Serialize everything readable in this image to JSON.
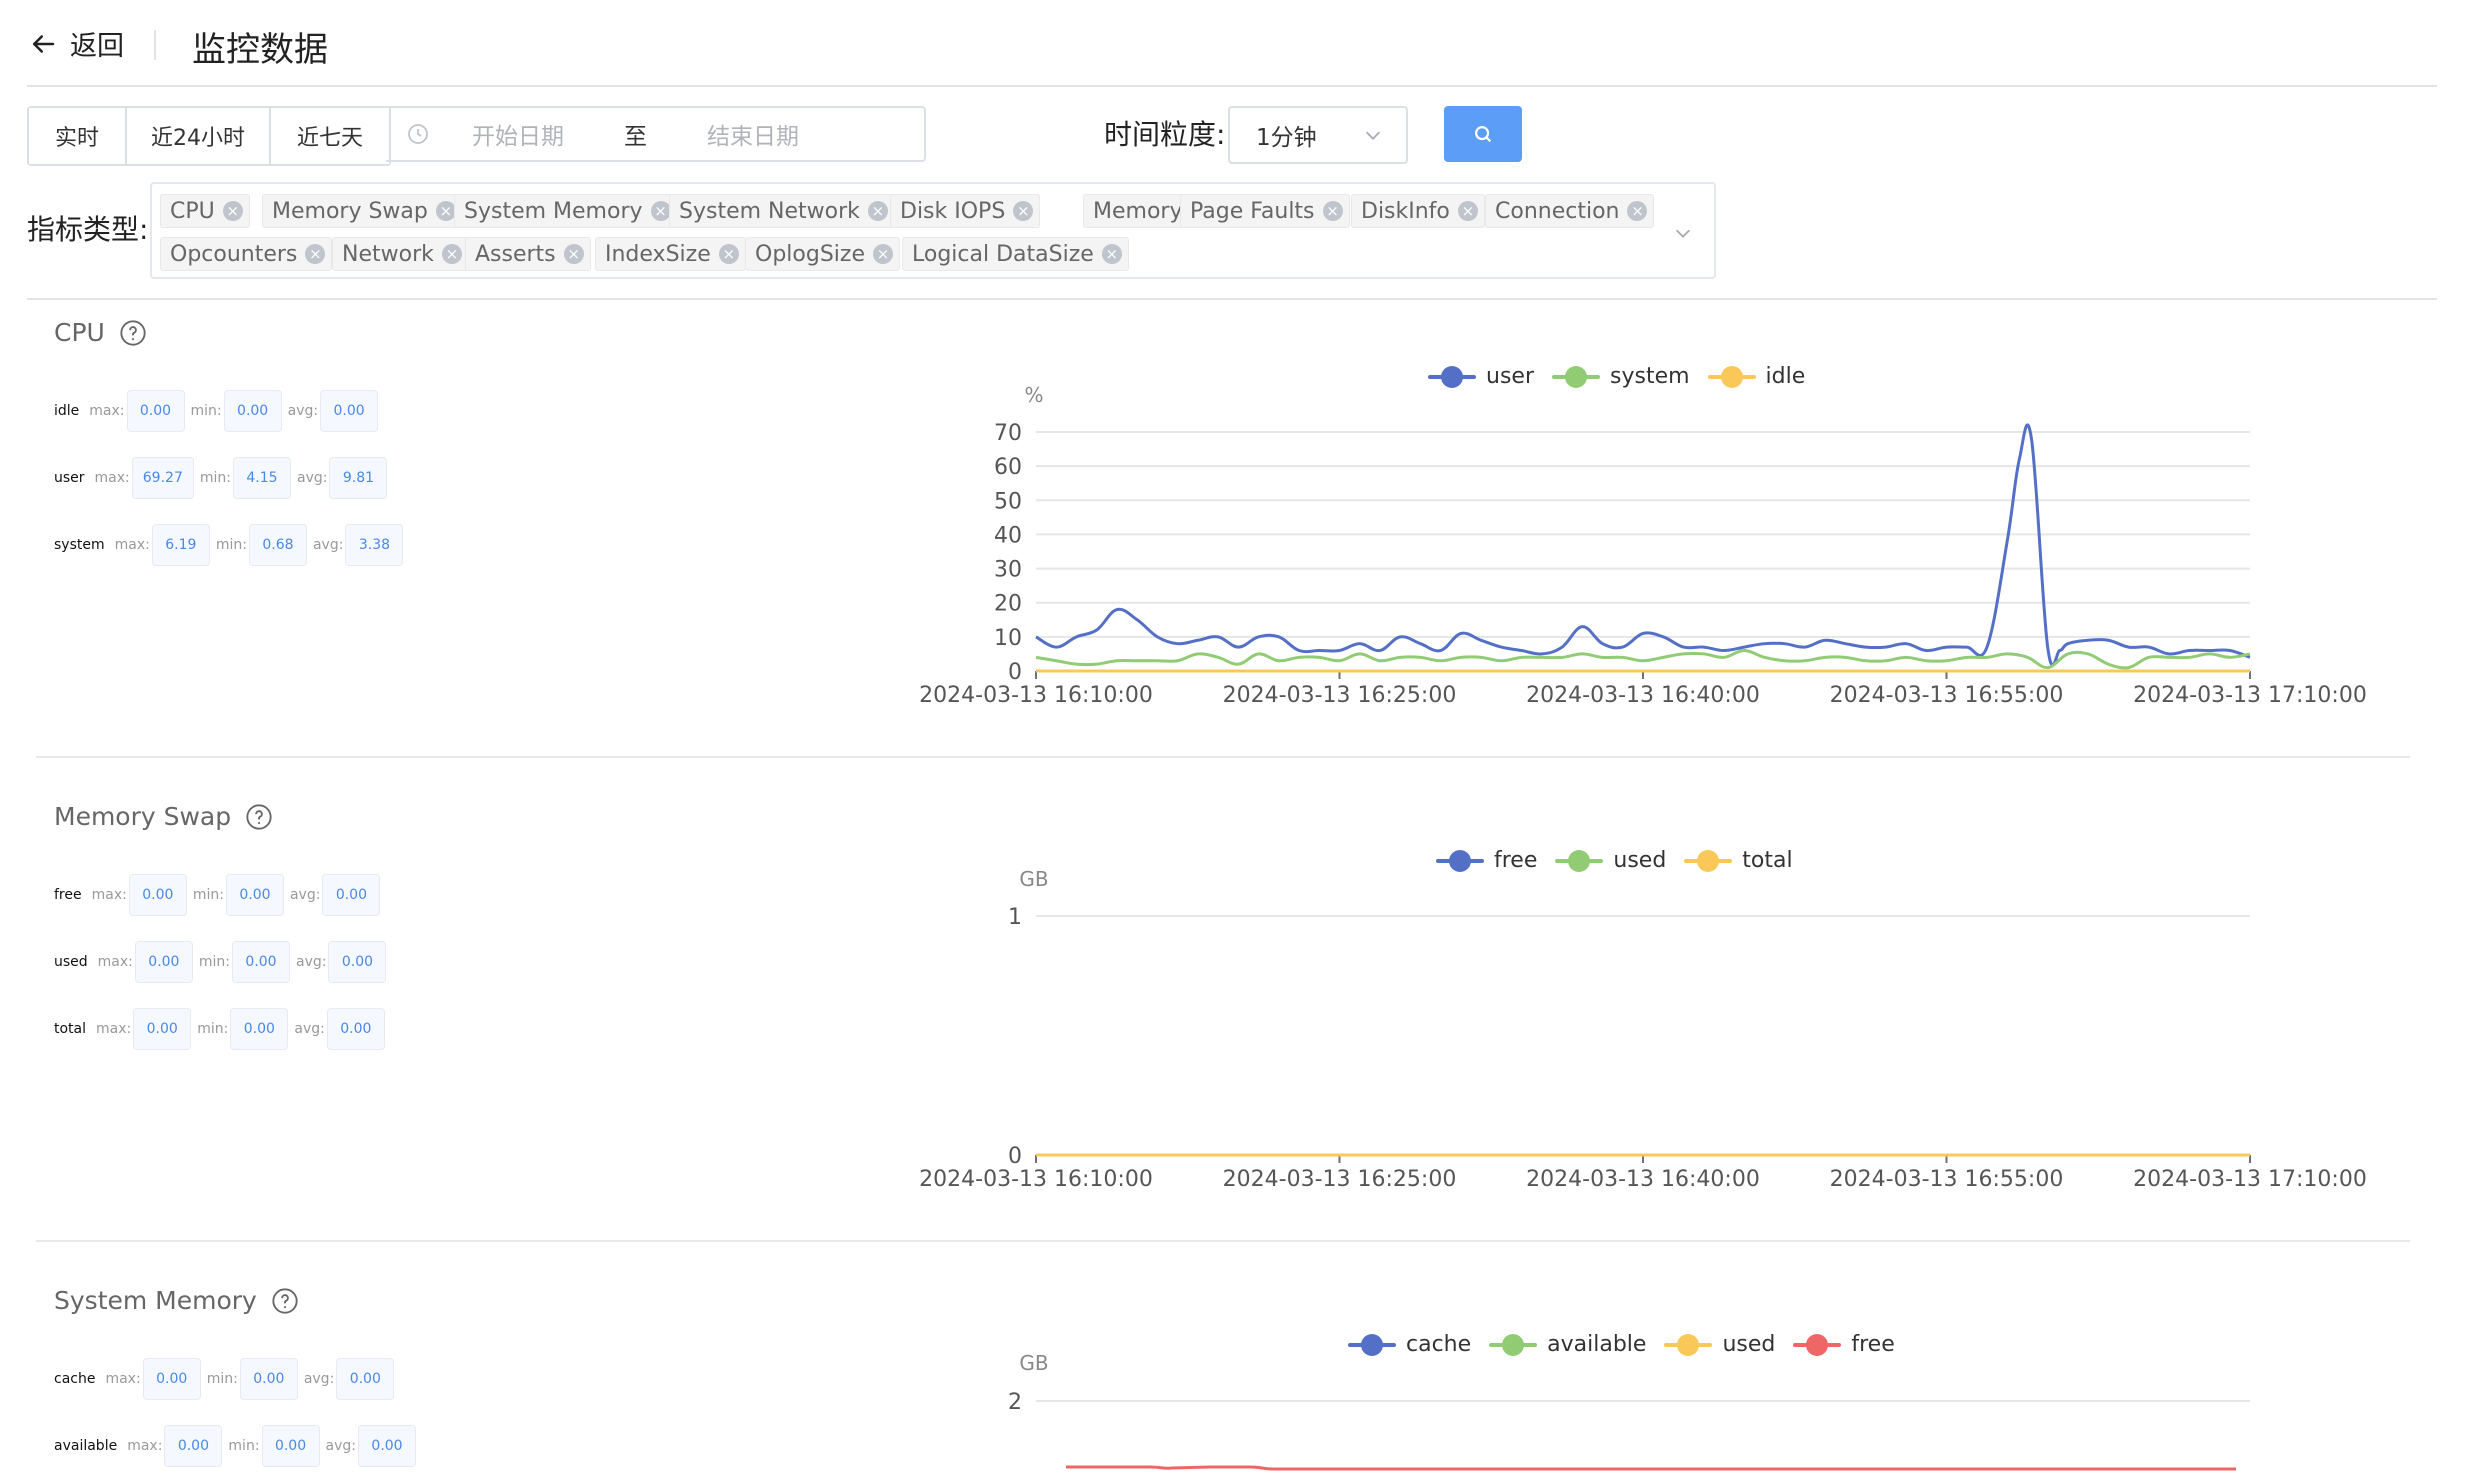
{
  "header": {
    "back_label": "返回",
    "title": "监控数据"
  },
  "toolbar": {
    "quick_ranges": [
      "实时",
      "近24小时",
      "近七天"
    ],
    "start_placeholder": "开始日期",
    "range_separator": "至",
    "end_placeholder": "结束日期",
    "granularity_label": "时间粒度:",
    "granularity_value": "1分钟",
    "metric_type_label": "指标类型:",
    "metric_tags": [
      "CPU",
      "Memory Swap",
      "System Memory",
      "System Network",
      "Disk IOPS",
      "Memory",
      "Page Faults",
      "DiskInfo",
      "Connection",
      "Opcounters",
      "Network",
      "Asserts",
      "IndexSize",
      "OplogSize",
      "Logical DataSize"
    ]
  },
  "colors": {
    "blue": "#5470c6",
    "green": "#91cc75",
    "yellow": "#fac858",
    "red": "#ee6666",
    "primary": "#5b9df7"
  },
  "sections": [
    {
      "title": "CPU",
      "stats": [
        {
          "name": "idle",
          "max": "0.00",
          "min": "0.00",
          "avg": "0.00"
        },
        {
          "name": "user",
          "max": "69.27",
          "min": "4.15",
          "avg": "9.81"
        },
        {
          "name": "system",
          "max": "6.19",
          "min": "0.68",
          "avg": "3.38"
        }
      ]
    },
    {
      "title": "Memory Swap",
      "stats": [
        {
          "name": "free",
          "max": "0.00",
          "min": "0.00",
          "avg": "0.00"
        },
        {
          "name": "used",
          "max": "0.00",
          "min": "0.00",
          "avg": "0.00"
        },
        {
          "name": "total",
          "max": "0.00",
          "min": "0.00",
          "avg": "0.00"
        }
      ]
    },
    {
      "title": "System Memory",
      "stats": [
        {
          "name": "cache",
          "max": "0.00",
          "min": "0.00",
          "avg": "0.00"
        },
        {
          "name": "available",
          "max": "0.00",
          "min": "0.00",
          "avg": "0.00"
        }
      ]
    }
  ],
  "stat_labels": {
    "max": "max:",
    "min": "min:",
    "avg": "avg:"
  },
  "chart_data": [
    {
      "type": "line",
      "unit": "%",
      "ylim": [
        0,
        70
      ],
      "yticks": [
        0,
        10,
        20,
        30,
        40,
        50,
        60,
        70
      ],
      "x_tick_labels": [
        "2024-03-13 16:10:00",
        "2024-03-13 16:25:00",
        "2024-03-13 16:40:00",
        "2024-03-13 16:55:00",
        "2024-03-13 17:10:00"
      ],
      "x_range_minutes": [
        0,
        60
      ],
      "series": [
        {
          "name": "user",
          "color": "#5470c6",
          "x": [
            0,
            1,
            2,
            3,
            4,
            5,
            6,
            7,
            8,
            9,
            10,
            11,
            12,
            13,
            14,
            15,
            16,
            17,
            18,
            19,
            20,
            21,
            22,
            23,
            24,
            25,
            26,
            27,
            28,
            29,
            30,
            31,
            32,
            33,
            34,
            35,
            36,
            37,
            38,
            39,
            40,
            41,
            42,
            43,
            44,
            45,
            46,
            47,
            48,
            48.6,
            49.2,
            50,
            50.6,
            51,
            52,
            53,
            54,
            55,
            56,
            57,
            58,
            59,
            60
          ],
          "y": [
            10,
            7,
            10,
            12,
            18,
            15,
            10,
            8,
            9,
            10,
            7,
            10,
            10,
            6,
            6,
            6,
            8,
            6,
            10,
            8,
            6,
            11,
            9,
            7,
            6,
            5,
            7,
            13,
            8,
            7,
            11,
            10,
            7,
            7,
            6,
            7,
            8,
            8,
            7,
            9,
            8,
            7,
            7,
            8,
            6,
            7,
            7,
            7,
            38,
            62,
            68,
            7,
            6,
            8,
            9,
            9,
            7,
            7,
            5,
            6,
            6,
            6,
            4
          ]
        },
        {
          "name": "system",
          "color": "#91cc75",
          "x": [
            0,
            1,
            2,
            3,
            4,
            5,
            6,
            7,
            8,
            9,
            10,
            11,
            12,
            13,
            14,
            15,
            16,
            17,
            18,
            19,
            20,
            21,
            22,
            23,
            24,
            25,
            26,
            27,
            28,
            29,
            30,
            31,
            32,
            33,
            34,
            35,
            36,
            37,
            38,
            39,
            40,
            41,
            42,
            43,
            44,
            45,
            46,
            47,
            48,
            49,
            50,
            51,
            52,
            53,
            54,
            55,
            56,
            57,
            58,
            59,
            60
          ],
          "y": [
            4,
            3,
            2,
            2,
            3,
            3,
            3,
            3,
            5,
            4,
            2,
            5,
            3,
            4,
            4,
            3,
            5,
            3,
            4,
            4,
            3,
            4,
            4,
            3,
            4,
            4,
            4,
            5,
            4,
            4,
            3,
            4,
            5,
            5,
            4,
            6,
            4,
            3,
            3,
            4,
            4,
            3,
            3,
            4,
            3,
            3,
            4,
            4,
            5,
            4,
            1,
            5,
            5,
            2,
            1,
            4,
            4,
            4,
            5,
            4,
            5
          ]
        },
        {
          "name": "idle",
          "color": "#fac858",
          "x": [
            0,
            60
          ],
          "y": [
            0,
            0
          ]
        }
      ]
    },
    {
      "type": "line",
      "unit": "GB",
      "ylim": [
        0,
        1
      ],
      "yticks": [
        0,
        1
      ],
      "x_tick_labels": [
        "2024-03-13 16:10:00",
        "2024-03-13 16:25:00",
        "2024-03-13 16:40:00",
        "2024-03-13 16:55:00",
        "2024-03-13 17:10:00"
      ],
      "x_range_minutes": [
        0,
        60
      ],
      "series": [
        {
          "name": "free",
          "color": "#5470c6",
          "x": [
            0,
            60
          ],
          "y": [
            0,
            0
          ]
        },
        {
          "name": "used",
          "color": "#91cc75",
          "x": [
            0,
            60
          ],
          "y": [
            0,
            0
          ]
        },
        {
          "name": "total",
          "color": "#fac858",
          "x": [
            0,
            60
          ],
          "y": [
            0,
            0
          ]
        }
      ]
    },
    {
      "type": "line",
      "unit": "GB",
      "yticks": [
        2
      ],
      "series": [
        {
          "name": "cache",
          "color": "#5470c6"
        },
        {
          "name": "available",
          "color": "#91cc75"
        },
        {
          "name": "used",
          "color": "#fac858"
        },
        {
          "name": "free",
          "color": "#ee6666"
        }
      ]
    }
  ]
}
